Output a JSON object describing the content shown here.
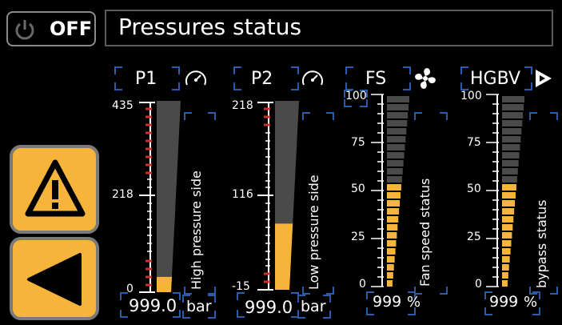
{
  "header": {
    "power_label": "OFF",
    "title": "Pressures status"
  },
  "sidebar": {
    "warning_icon": "warning-icon",
    "back_icon": "back-arrow-icon"
  },
  "gauges": [
    {
      "name": "P1",
      "icon": "gauge-icon",
      "scale_max": "435",
      "scale_mid": "218",
      "scale_min": "0",
      "level": 0.08,
      "side_label": "High pressure side",
      "value": "999.0",
      "unit": "bar"
    },
    {
      "name": "P2",
      "icon": "gauge-icon",
      "scale_max": "218",
      "scale_mid": "116",
      "scale_min": "-15",
      "level": 0.35,
      "side_label": "Low pressure side",
      "value": "999.0",
      "unit": "bar"
    },
    {
      "name": "FS",
      "icon": "fan-icon",
      "scale": [
        "100",
        "75",
        "50",
        "25",
        "0"
      ],
      "level": 0.55,
      "side_label": "Fan speed status",
      "value": "999",
      "unit": "%"
    },
    {
      "name": "HGBV",
      "icon": "play-arrow-icon",
      "scale": [
        "100",
        "75",
        "50",
        "25",
        "0"
      ],
      "level": 0.55,
      "side_label": "bypass status",
      "value": "999",
      "unit": "%"
    }
  ],
  "colors": {
    "accent": "#f6b53a",
    "bar_empty": "#4a4a4a",
    "tick_red": "#d0302a",
    "frame_blue": "#2c5ba8"
  }
}
